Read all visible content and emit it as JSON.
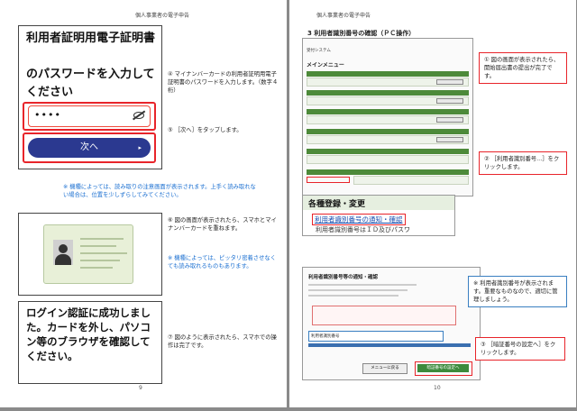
{
  "left_page": {
    "header": "個人事業者の電子申告",
    "page_number": "9",
    "phone1": {
      "title": "利用者証明用電子証明書",
      "subtitle": "のパスワードを入力してください",
      "password_mask": "••••",
      "next_label": "次へ",
      "next_arrow": "▸"
    },
    "step4": {
      "marker": "④",
      "text": "マイナンバーカードの利用者証明用電子証明書のパスワードを入力します。（数字４桁）"
    },
    "step5": {
      "marker": "⑤",
      "text": "［次へ］をタップします。"
    },
    "note1": "※ 機種によっては、読み取りの注意画面が表示されます。上手く読み取れない場合は、位置を少しずらしてみてください。",
    "step6": {
      "marker": "⑥",
      "text": "図の画面が表示されたら、スマホとマイナンバーカードを重ねます。"
    },
    "note2": "※ 機種によっては、ピッタリ密着させなくても読み取れるものもあります。",
    "phone3_text": "ログイン認証に成功しました。カードを外し、パソコン等のブラウザを確認してください。",
    "step7": {
      "marker": "⑦",
      "text": "図のように表示されたら、スマホでの操作は完了です。"
    }
  },
  "right_page": {
    "header": "個人事業者の電子申告",
    "page_number": "10",
    "section_title": "3  利用者識別番号の確認（ＰＣ操作）",
    "shot1": {
      "system_name": "受付システム",
      "menu_title": "メインメニュー"
    },
    "callout1": {
      "marker": "①",
      "text": "図の画面が表示されたら、開始届出書の提出が完了です。"
    },
    "callout2": {
      "marker": "②",
      "text": "［利用者識別番号…］をクリックします。"
    },
    "zoom": {
      "heading": "各種登録・変更",
      "link": "利用者識別番号の通知・確認",
      "subtext": "利用者識別番号はＩＤ及びパスワ"
    },
    "shot2": {
      "title": "利用者識別番号等の通知・確認",
      "field_label": "利用者識別番号",
      "menu_button": "メニューに戻る",
      "set_button": "暗証番号の設定へ"
    },
    "callout3": {
      "text": "※ 利用者識別番号が表示されます。重要なものなので、適切に管理しましょう。"
    },
    "callout4": {
      "marker": "③",
      "text": "［暗証番号の設定へ］をクリックします。"
    }
  }
}
